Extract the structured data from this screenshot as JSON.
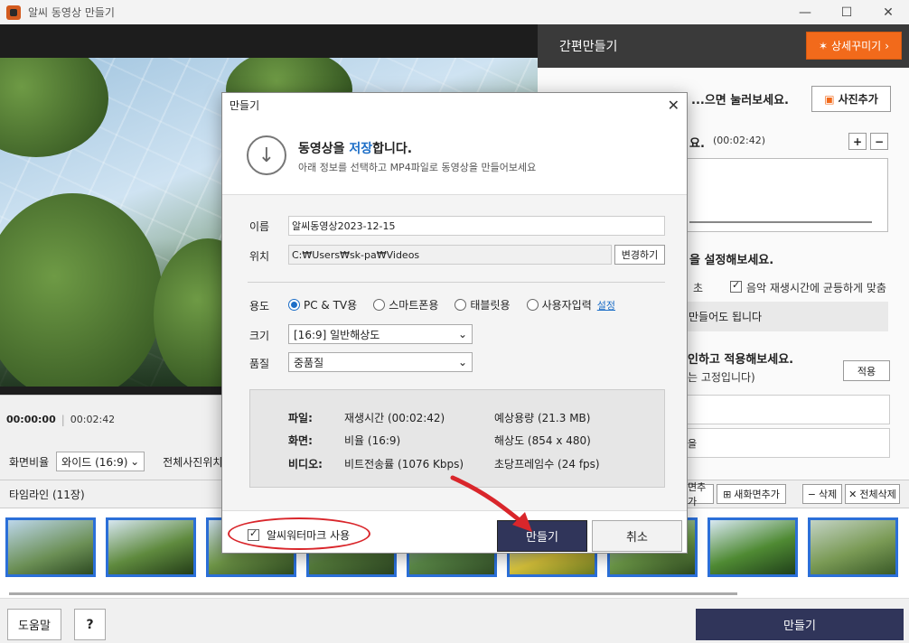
{
  "window": {
    "title": "알씨 동영상 만들기",
    "minimize": "—",
    "maximize": "☐",
    "close": "✕"
  },
  "player": {
    "current_time": "00:00:00",
    "separator": "|",
    "total_time": "00:02:42"
  },
  "ratio": {
    "label": "화면비율",
    "value": "와이드 (16:9)",
    "position_label": "전체사진위치"
  },
  "right_panel": {
    "title": "간편만들기",
    "detail_button": "상세꾸미기",
    "photo_add": "사진추가",
    "text1": "...으면 눌러보세요.",
    "text2": "요.",
    "text2_time": "(00:02:42)",
    "plus": "+",
    "minus": "−",
    "text3": "을 설정해보세요.",
    "sec_label": "초",
    "music_sync": "음악 재생시간에 균등하게 맞춤",
    "grey_text": "만들어도 됩니다",
    "text4": "인하고 적용해보세요.",
    "text5": "는 고정입니다)",
    "apply": "적용",
    "box_text": "을"
  },
  "timeline": {
    "title": "타임라인 (11장)",
    "buttons": {
      "add_end": "면추가",
      "add_new": "새화면추가",
      "delete": "삭제",
      "delete_all": "전체삭제"
    },
    "thumbnail_count": 9
  },
  "bottom": {
    "help": "도움말",
    "question": "?",
    "make": "만들기"
  },
  "dialog": {
    "title": "만들기",
    "close": "✕",
    "heading_prefix": "동영상을 ",
    "heading_accent": "저장",
    "heading_suffix": "합니다.",
    "subtitle": "아래 정보를 선택하고 MP4파일로 동영상을 만들어보세요",
    "name_label": "이름",
    "name_value": "알씨동영상2023-12-15",
    "location_label": "위치",
    "location_value": "C:₩Users₩sk-pa₩Videos",
    "change_button": "변경하기",
    "usage_label": "용도",
    "usage_options": [
      "PC & TV용",
      "스마트폰용",
      "태블릿용",
      "사용자입력"
    ],
    "usage_selected": 0,
    "settings_link": "설정",
    "size_label": "크기",
    "size_value": "[16:9] 일반해상도",
    "quality_label": "품질",
    "quality_value": "중품질",
    "info": {
      "file_label": "파일:",
      "screen_label": "화면:",
      "video_label": "비디오:",
      "duration": "재생시간 (00:02:42)",
      "est_size": "예상용량 (21.3 MB)",
      "ratio": "비율 (16:9)",
      "resolution": "해상도 (854 x 480)",
      "bitrate": "비트전송률 (1076 Kbps)",
      "fps": "초당프레임수 (24 fps)"
    },
    "watermark_label": "알씨워터마크 사용",
    "watermark_checked": true,
    "make_button": "만들기",
    "cancel_button": "취소"
  },
  "colors": {
    "accent_orange": "#f26a1b",
    "navy_button": "#30355a",
    "link_blue": "#1d6ec7",
    "highlight_red": "#d9262b",
    "thumb_border": "#2b6fd8"
  }
}
